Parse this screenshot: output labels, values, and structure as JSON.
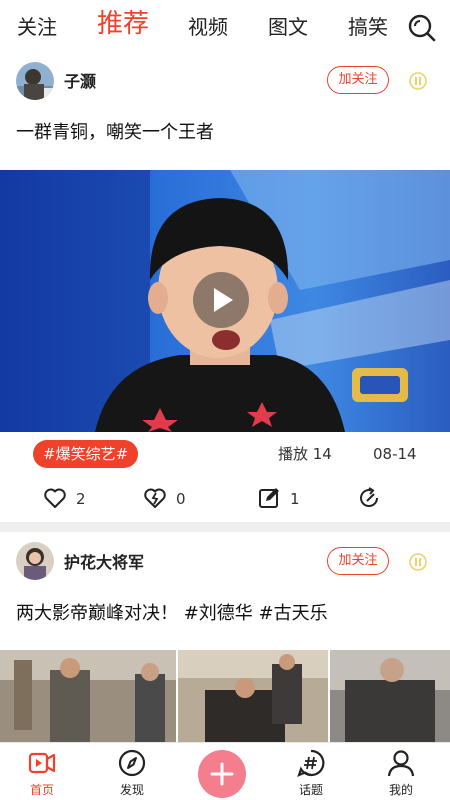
{
  "tabs": [
    "关注",
    "推荐",
    "视频",
    "图文",
    "搞笑"
  ],
  "active_tab": "推荐",
  "posts": [
    {
      "author": "子灏",
      "follow_label": "加关注",
      "text": "一群青铜，嘲笑一个王者",
      "tag": "#爆笑综艺#",
      "plays": "播放 14",
      "date": "08-14",
      "likes": "2",
      "dislikes": "0",
      "comments": "1"
    },
    {
      "author": "护花大将军",
      "follow_label": "加关注",
      "text": "两大影帝巅峰对决！ #刘德华 #古天乐"
    }
  ],
  "bottom_nav": [
    {
      "label": "首页"
    },
    {
      "label": "发现"
    },
    {
      "label": "话题"
    },
    {
      "label": "我的"
    }
  ],
  "colors": {
    "accent": "#f0412b",
    "add_button": "#f57e8e",
    "separator": "#efefef"
  },
  "icons": [
    "search-icon",
    "pause-icon",
    "play-icon",
    "heart-icon",
    "broken-heart-icon",
    "edit-icon",
    "share-icon",
    "home-video-icon",
    "compass-icon",
    "plus-icon",
    "hashtag-icon",
    "user-icon"
  ]
}
